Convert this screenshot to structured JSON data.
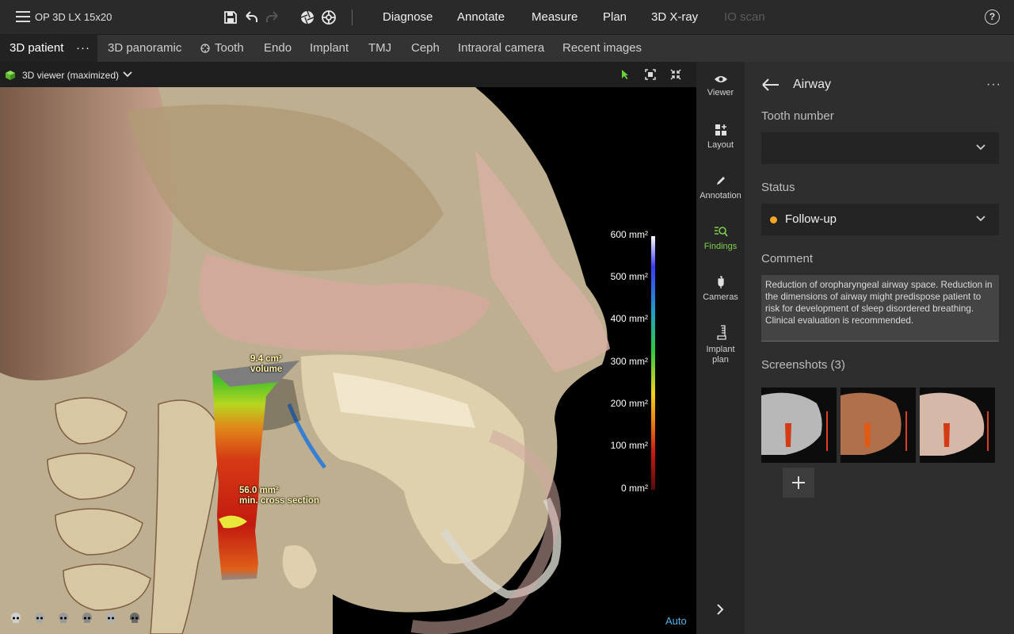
{
  "app": {
    "device_name": "OP 3D LX 15x20"
  },
  "toolbar": {
    "icons": [
      "menu-icon",
      "save-icon",
      "undo-icon",
      "redo-icon",
      "aperture-icon",
      "target-icon",
      "help-icon"
    ],
    "nav": [
      {
        "label": "Diagnose",
        "enabled": true
      },
      {
        "label": "Annotate",
        "enabled": true
      },
      {
        "label": "Measure",
        "enabled": true
      },
      {
        "label": "Plan",
        "enabled": true
      },
      {
        "label": "3D X-ray",
        "enabled": true
      },
      {
        "label": "IO scan",
        "enabled": false
      }
    ],
    "help_label": "?"
  },
  "tabs": {
    "active": "3D patient",
    "active_more": "···",
    "items": [
      "3D panoramic",
      "Tooth",
      "Endo",
      "Implant",
      "TMJ",
      "Ceph",
      "Intraoral camera",
      "Recent images"
    ]
  },
  "viewer": {
    "title": "3D viewer (maximized)",
    "scale_labels": [
      "600 mm²",
      "500 mm²",
      "400 mm²",
      "300 mm²",
      "200 mm²",
      "100 mm²",
      "0 mm²"
    ],
    "annotations": {
      "volume_value": "9.4 cm³",
      "volume_label": "volume",
      "cross_value": "56.0 mm²",
      "cross_label": "min. cross section"
    },
    "auto_label": "Auto",
    "colors": {
      "scale_top": "#ffffff",
      "scale_mid": "#2ecc40",
      "scale_bottom": "#8b0000",
      "auto": "#4fb3e8"
    }
  },
  "side_tools": [
    {
      "label": "Viewer",
      "icon": "eye-icon",
      "active": false
    },
    {
      "label": "Layout",
      "icon": "layout-icon",
      "active": false
    },
    {
      "label": "Annotation",
      "icon": "pencil-icon",
      "active": false
    },
    {
      "label": "Findings",
      "icon": "findings-icon",
      "active": true
    },
    {
      "label": "Cameras",
      "icon": "camera-icon",
      "active": false
    },
    {
      "label": "Implant",
      "label2": "plan",
      "icon": "implant-icon",
      "active": false
    }
  ],
  "panel": {
    "title": "Airway",
    "more": "···",
    "tooth_number": {
      "label": "Tooth number",
      "value": ""
    },
    "status": {
      "label": "Status",
      "value": "Follow-up",
      "dot_color": "#f5a623"
    },
    "comment": {
      "label": "Comment",
      "text": "Reduction of oropharyngeal airway space. Reduction in the dimensions of airway might predispose patient to risk for development of sleep disordered breathing. Clinical evaluation is recommended."
    },
    "screenshots": {
      "label": "Screenshots (3)",
      "count": 3
    }
  }
}
